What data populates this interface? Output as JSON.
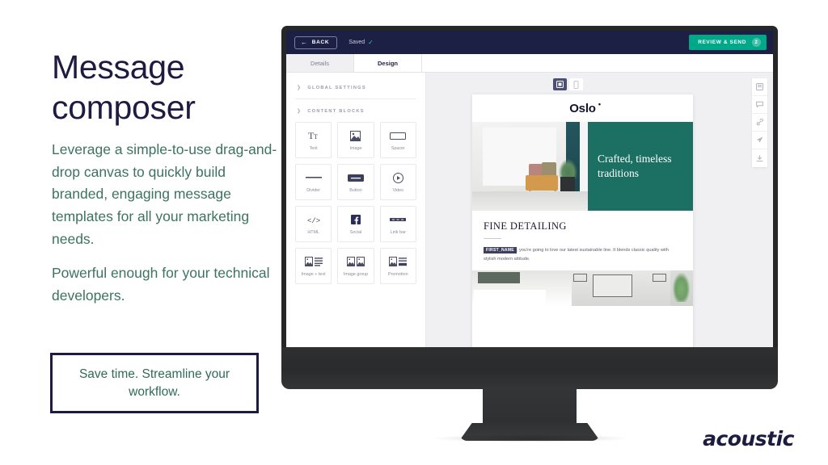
{
  "slide": {
    "title": "Message composer",
    "paragraphs": [
      "Leverage a simple-to-use drag-and-drop canvas to quickly build branded, engaging message templates for all your marketing needs.",
      "Powerful enough for your technical developers."
    ],
    "callout": "Save time. Streamline your workflow.",
    "brand_logo": "acoustic",
    "colors": {
      "title": "#1d1b3f",
      "body": "#3c7361",
      "callout_border": "#1d1b3f",
      "callout_text": "#2f6b58",
      "accent_teal": "#00a88a",
      "app_navy": "#1c2045"
    }
  },
  "app": {
    "topbar": {
      "back_label": "BACK",
      "back_icon": "arrow-left-icon",
      "saved_label": "Saved",
      "saved_icon": "check-icon",
      "review_label": "REVIEW & SEND",
      "review_badge": "2"
    },
    "tabs": [
      {
        "label": "Details",
        "active": false
      },
      {
        "label": "Design",
        "active": true
      }
    ],
    "palette": {
      "sections": [
        {
          "label": "GLOBAL SETTINGS",
          "icon": "chevron-right-icon"
        },
        {
          "label": "CONTENT BLOCKS",
          "icon": "chevron-right-icon"
        }
      ],
      "tiles": [
        {
          "label": "Text",
          "icon": "text-icon"
        },
        {
          "label": "Image",
          "icon": "image-icon"
        },
        {
          "label": "Spacer",
          "icon": "spacer-icon"
        },
        {
          "label": "Divider",
          "icon": "divider-icon"
        },
        {
          "label": "Button",
          "icon": "button-icon"
        },
        {
          "label": "Video",
          "icon": "video-icon"
        },
        {
          "label": "HTML",
          "icon": "code-icon"
        },
        {
          "label": "Social",
          "icon": "facebook-icon"
        },
        {
          "label": "Link bar",
          "icon": "link-bar-icon"
        },
        {
          "label": "Image + text",
          "icon": "image-text-icon"
        },
        {
          "label": "Image group",
          "icon": "image-group-icon"
        },
        {
          "label": "Promotion",
          "icon": "promotion-icon"
        }
      ]
    },
    "view_toggle": [
      {
        "icon": "desktop-view-icon",
        "active": true
      },
      {
        "icon": "mobile-view-icon",
        "active": false
      }
    ],
    "rail_icons": [
      "preview-icon",
      "comment-icon",
      "link-icon",
      "send-icon",
      "download-icon"
    ],
    "email": {
      "logo": "Oslo",
      "logo_mark": "•",
      "hero_heading": "Crafted, timeless traditions",
      "section_title": "FINE DETAILING",
      "token": "FIRST_NAME",
      "section_body": ", you're going to love our latest sustainable line.  It blends classic quality with stylish modern attitude."
    }
  }
}
